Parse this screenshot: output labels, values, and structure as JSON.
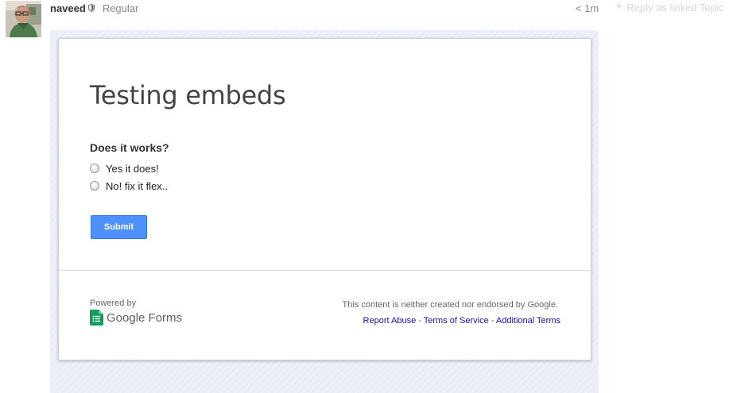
{
  "post": {
    "author": "naveed",
    "role": "Regular",
    "timestamp": "< 1m",
    "reply_label": "Reply as linked Topic"
  },
  "form": {
    "title": "Testing embeds",
    "question": "Does it works?",
    "options": [
      "Yes it does!",
      "No! fix it flex.."
    ],
    "submit_label": "Submit",
    "footer": {
      "powered_by": "Powered by",
      "logo_text": "Google Forms",
      "disclaimer": "This content is neither created nor endorsed by Google.",
      "links": [
        "Report Abuse",
        "Terms of Service",
        "Additional Terms"
      ],
      "separator": " - "
    }
  },
  "colors": {
    "submit": "#4d90fe",
    "link": "#1a0dab",
    "forms_green": "#0f9d58"
  },
  "icons": [
    "user-avatar",
    "shield-icon",
    "plus-icon",
    "radio-icon",
    "google-forms-icon"
  ]
}
